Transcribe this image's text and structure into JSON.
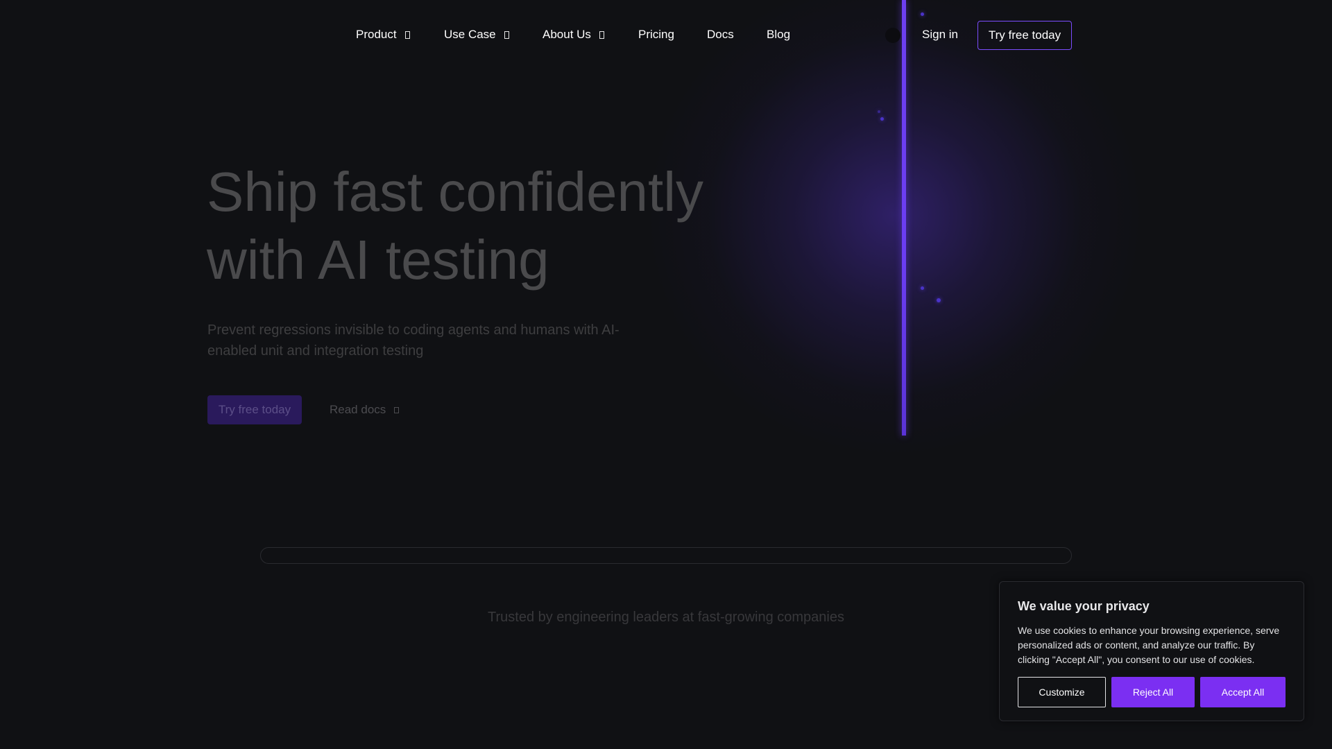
{
  "nav": {
    "items": [
      {
        "label": "Product",
        "has_dropdown": true
      },
      {
        "label": "Use Case",
        "has_dropdown": true
      },
      {
        "label": "About Us",
        "has_dropdown": true
      },
      {
        "label": "Pricing",
        "has_dropdown": false
      },
      {
        "label": "Docs",
        "has_dropdown": false
      },
      {
        "label": "Blog",
        "has_dropdown": false
      }
    ],
    "sign_in": "Sign in",
    "cta": "Try free today"
  },
  "hero": {
    "title_line1": "Ship fast confidently",
    "title_line2": "with AI testing",
    "subtitle": "Prevent regressions invisible to coding agents and humans with AI-enabled unit and integration testing",
    "primary_cta": "Try free today",
    "secondary_cta": "Read docs"
  },
  "trusted": {
    "text": "Trusted by engineering leaders at fast-growing companies"
  },
  "cookie": {
    "title": "We value your privacy",
    "text": "We use cookies to enhance your browsing experience, serve personalized ads or content, and analyze our traffic. By clicking \"Accept All\", you consent to our use of cookies.",
    "customize": "Customize",
    "reject": "Reject All",
    "accept": "Accept All"
  },
  "colors": {
    "background": "#101114",
    "accent": "#7b2ff2",
    "beam": "#6d3ff0"
  },
  "icons": {
    "dropdown": "chevron-down-icon",
    "external": "external-link-icon"
  }
}
